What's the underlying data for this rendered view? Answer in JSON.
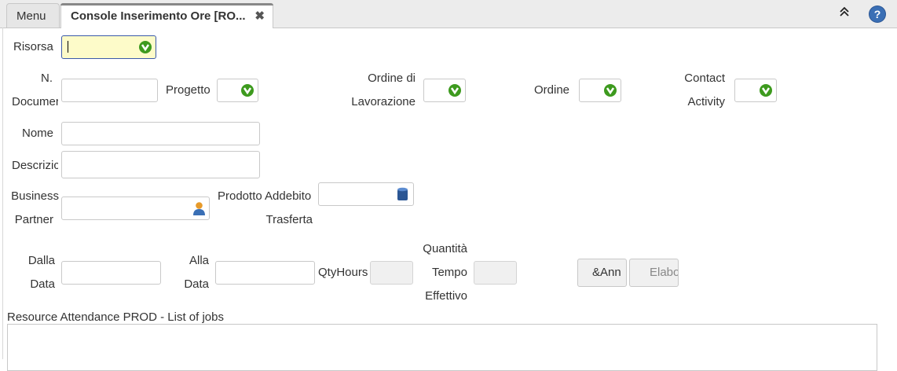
{
  "tabs": {
    "menu_label": "Menu",
    "active_label": "Console Inserimento Ore [RO...",
    "close_glyph": "✖"
  },
  "header_icons": {
    "collapse": "chevrons-up-icon",
    "help": "help-icon",
    "help_glyph": "?"
  },
  "form": {
    "risorsa_label": "Risorsa",
    "risorsa_value": "",
    "ndoc_label_1": "N.",
    "ndoc_label_2": "Documer",
    "progetto_label": "Progetto",
    "odl_label_1": "Ordine di",
    "odl_label_2": "Lavorazione",
    "ordine_label": "Ordine",
    "contact_label_1": "Contact",
    "contact_label_2": "Activity",
    "nome_label": "Nome",
    "descr_label": "Descrizic",
    "bp_label_1": "Business",
    "bp_label_2": "Partner",
    "prodotto_label_1": "Prodotto Addebito",
    "prodotto_label_2": "Trasferta",
    "dalla_label_1": "Dalla",
    "dalla_label_2": "Data",
    "alla_label_1": "Alla",
    "alla_label_2": "Data",
    "qty_label": "QtyHours",
    "qte_label_1": "Quantità",
    "qte_label_2": "Tempo",
    "qte_label_3": "Effettivo"
  },
  "buttons": {
    "annulla": "&Ann",
    "elabora": "Elabo"
  },
  "grid": {
    "title": "Resource Attendance PROD - List of jobs"
  },
  "colors": {
    "required_field": "#fdfbc9",
    "focus_border": "#3b5aa9",
    "help_blue": "#3a6fb5",
    "lookup_green": "#3d9a1e"
  }
}
